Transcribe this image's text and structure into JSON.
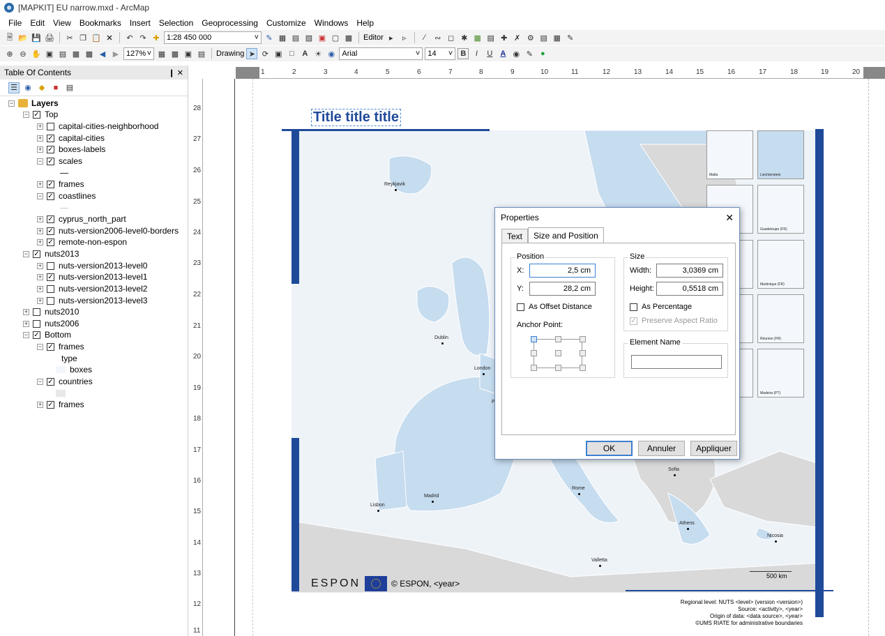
{
  "window": {
    "title": "[MAPKIT] EU narrow.mxd - ArcMap"
  },
  "menu": [
    "File",
    "Edit",
    "View",
    "Bookmarks",
    "Insert",
    "Selection",
    "Geoprocessing",
    "Customize",
    "Windows",
    "Help"
  ],
  "toolbar": {
    "scale_value": "1:28 450 000",
    "editor_label": "Editor",
    "zoom_value": "127%",
    "drawing_label": "Drawing",
    "font_name": "Arial",
    "font_size": "14",
    "bold": "B",
    "italic": "I",
    "underline": "U",
    "text_a": "A"
  },
  "toc": {
    "title": "Table Of Contents",
    "pin": "❙ ✕",
    "items": [
      {
        "label": "Layers",
        "bold": true
      },
      {
        "label": "Top"
      },
      {
        "label": "capital-cities-neighborhood"
      },
      {
        "label": "capital-cities"
      },
      {
        "label": "boxes-labels"
      },
      {
        "label": "scales"
      },
      {
        "label": "frames"
      },
      {
        "label": "coastlines"
      },
      {
        "label": "cyprus_north_part"
      },
      {
        "label": "nuts-version2006-level0-borders"
      },
      {
        "label": "remote-non-espon"
      },
      {
        "label": "nuts2013"
      },
      {
        "label": "nuts-version2013-level0"
      },
      {
        "label": "nuts-version2013-level1"
      },
      {
        "label": "nuts-version2013-level2"
      },
      {
        "label": "nuts-version2013-level3"
      },
      {
        "label": "nuts2010"
      },
      {
        "label": "nuts2006"
      },
      {
        "label": "Bottom"
      },
      {
        "label": "frames"
      },
      {
        "label": "type"
      },
      {
        "label": "boxes"
      },
      {
        "label": "countries"
      },
      {
        "label": "frames"
      }
    ]
  },
  "ruler": {
    "horizontal": [
      "1",
      "2",
      "3",
      "4",
      "5",
      "6",
      "7",
      "8",
      "9",
      "10",
      "11",
      "12",
      "13",
      "14",
      "15",
      "16",
      "17",
      "18",
      "19",
      "20"
    ],
    "vertical": [
      "28",
      "27",
      "26",
      "25",
      "24",
      "23",
      "22",
      "21",
      "20",
      "19",
      "18",
      "17",
      "16",
      "15",
      "14",
      "13",
      "12",
      "11"
    ]
  },
  "map": {
    "title": "Title title title",
    "cities": [
      "Reykjavik",
      "Dublin",
      "London",
      "Madrid",
      "Lisbon",
      "Rome",
      "Sofia",
      "Athens",
      "Valletta",
      "Nicosia",
      "Pa"
    ],
    "insets": [
      "Malta",
      "Liechtenstein",
      "Guadeloupe (FR)",
      "Martinique (FR)",
      "Réunion (FR)",
      "Madeira (PT)"
    ],
    "scalebar": "500 km",
    "logo": "ESPON",
    "copyright": "© ESPON, <year>",
    "source_lines": [
      "Regional level: NUTS <level> (version <version>)",
      "Source: <activity>, <year>",
      "Origin of data: <data source>, <year>",
      "©UMS RIATE for administrative boundaries"
    ]
  },
  "dialog": {
    "title": "Properties",
    "tabs": [
      "Text",
      "Size and Position"
    ],
    "position_group": "Position",
    "x_label": "X:",
    "x_value": "2,5 cm",
    "y_label": "Y:",
    "y_value": "28,2 cm",
    "offset_label": "As Offset Distance",
    "anchor_label": "Anchor Point:",
    "size_group": "Size",
    "width_label": "Width:",
    "width_value": "3,0369 cm",
    "height_label": "Height:",
    "height_value": "0,5518 cm",
    "percentage_label": "As Percentage",
    "aspect_label": "Preserve Aspect Ratio",
    "element_group": "Element Name",
    "element_value": "",
    "ok": "OK",
    "cancel": "Annuler",
    "apply": "Appliquer"
  }
}
